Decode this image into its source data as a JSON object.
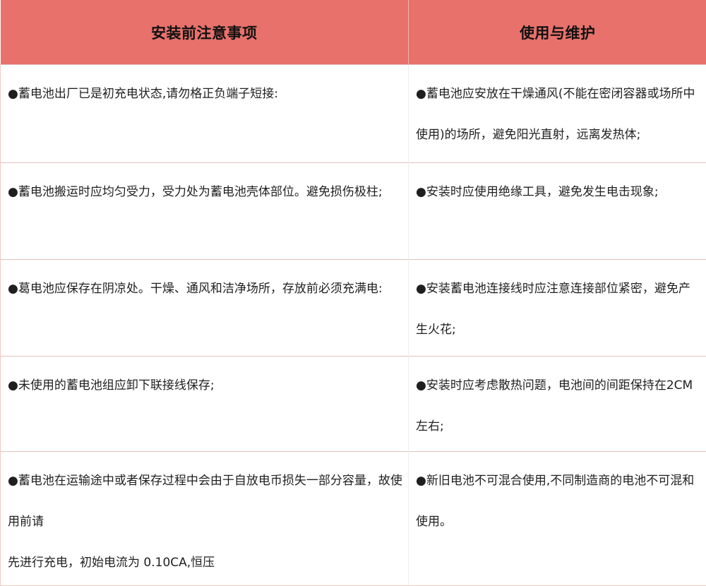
{
  "table": {
    "headers": [
      "安装前注意事项",
      "使用与维护"
    ],
    "rows": [
      {
        "left": [
          "●蓄电池出厂已是初充电状态,请勿格正负端子短接:"
        ],
        "right": [
          "●蓄电池应安放在干燥通风(不能在密闭容器或场所中使用)的场所，避免阳光直射，远离发热体;"
        ]
      },
      {
        "left": [
          "●蓄电池搬运时应均匀受力，受力处为蓄电池壳体部位。避免损伤极柱;"
        ],
        "right": [
          "●安装时应使用绝缘工具，避免发生电击现象;"
        ]
      },
      {
        "left": [
          "●葛电池应保存在阴凉处。干燥、通风和洁净场所，存放前必须充满电:"
        ],
        "right": [
          "●安装蓄电池连接线时应注意连接部位紧密，避免产生火花;"
        ]
      },
      {
        "left": [
          "●未使用的蓄电池组应卸下联接线保存;"
        ],
        "right": [
          "●安装时应考虑散热问题，电池间的间距保持在2CM 左右;"
        ]
      },
      {
        "left": [
          "●蓄电池在运输途中或者保存过程中会由于自放电币损失一部分容量，故使用前请",
          "先进行充电，初始电流为 0.10CA,恒压"
        ],
        "right": [
          "●新旧电池不可混合使用,不同制造商的电池不可混和使用。"
        ]
      }
    ]
  },
  "colors": {
    "header_bg": "#e8716b",
    "header_text": "#111111",
    "body_text": "#1f1f1f",
    "border": "#e2c0be"
  }
}
